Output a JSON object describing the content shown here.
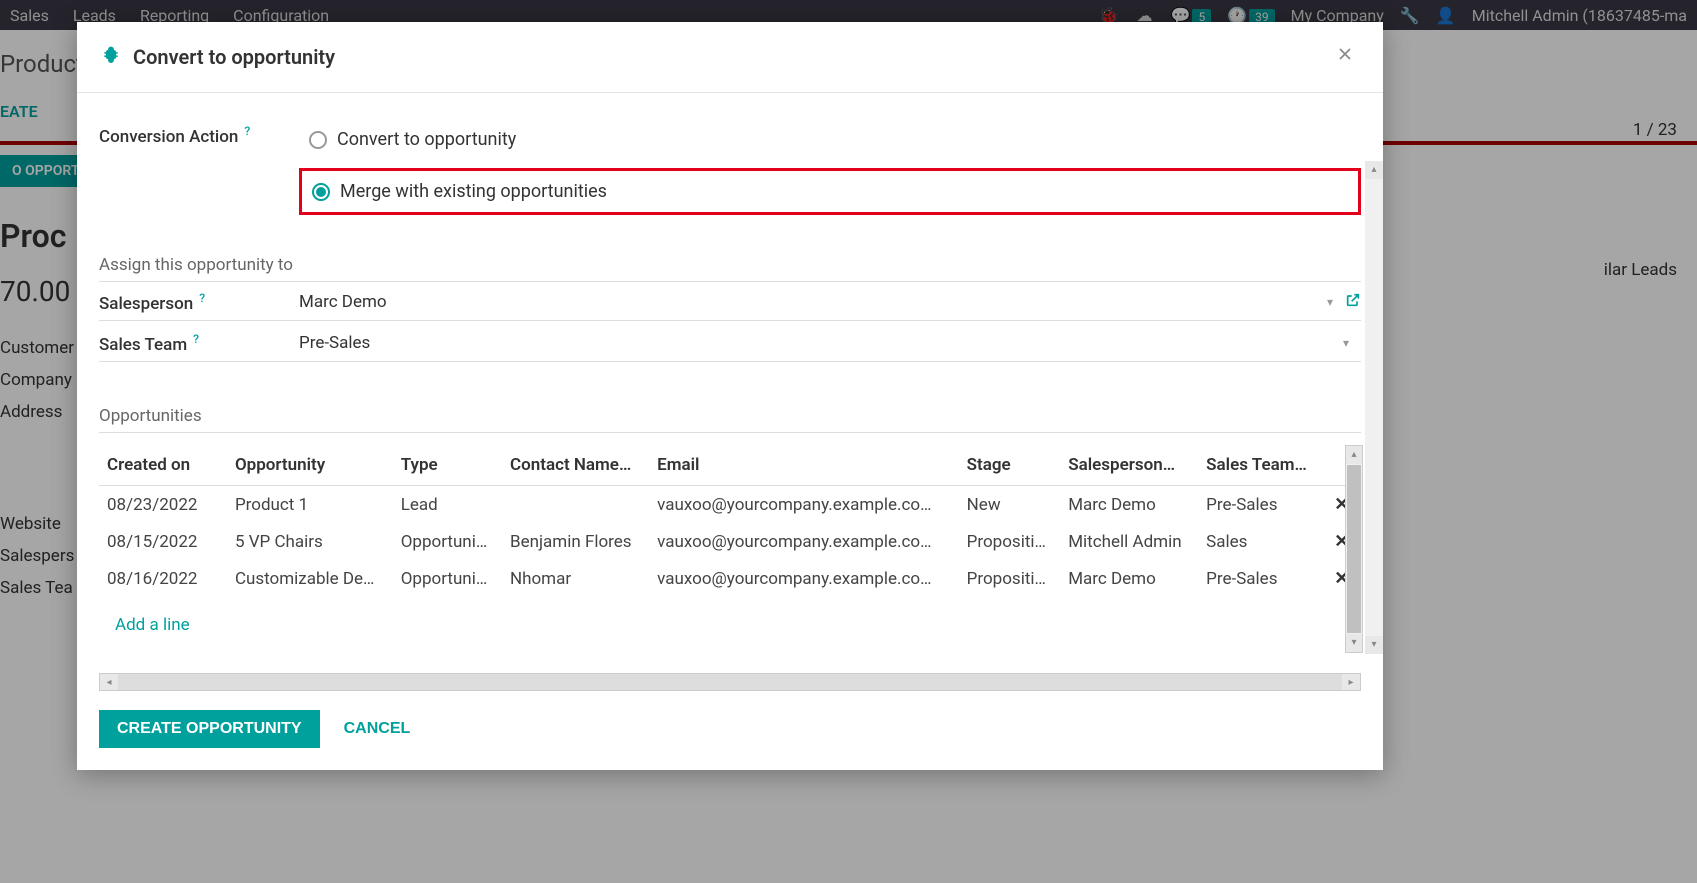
{
  "nav": {
    "items": [
      "Sales",
      "Leads",
      "Reporting",
      "Configuration"
    ],
    "badge1": "5",
    "badge2": "39",
    "company": "My Company",
    "user": "Mitchell Admin (18637485-ma"
  },
  "bg": {
    "product": "Product",
    "create": "EATE",
    "opport": "O OPPORT",
    "big": "Proc",
    "num": "70.00",
    "customer": "Customer",
    "company": "Company",
    "address": "Address",
    "website": "Website",
    "salespers": "Salespers",
    "salestea": "Sales Tea",
    "pager": "1 / 23",
    "similar": "ilar Leads"
  },
  "modal": {
    "title": "Convert to opportunity",
    "conversion_label": "Conversion Action",
    "radio1": "Convert to opportunity",
    "radio2": "Merge with existing opportunities",
    "assign_header": "Assign this opportunity to",
    "salesperson_label": "Salesperson",
    "salesperson_value": "Marc Demo",
    "salesteam_label": "Sales Team",
    "salesteam_value": "Pre-Sales",
    "opps_header": "Opportunities",
    "columns": {
      "created": "Created on",
      "opp": "Opportunity",
      "type": "Type",
      "contact": "Contact Name…",
      "email": "Email",
      "stage": "Stage",
      "sp": "Salesperson…",
      "st": "Sales Team…"
    },
    "rows": [
      {
        "created": "08/23/2022",
        "opp": "Product 1",
        "type": "Lead",
        "contact": "",
        "email": "vauxoo@yourcompany.example.co…",
        "stage": "New",
        "sp": "Marc Demo",
        "st": "Pre-Sales"
      },
      {
        "created": "08/15/2022",
        "opp": "5 VP Chairs",
        "type": "Opportuni…",
        "contact": "Benjamin Flores",
        "email": "vauxoo@yourcompany.example.co…",
        "stage": "Propositi…",
        "sp": "Mitchell Admin",
        "st": "Sales"
      },
      {
        "created": "08/16/2022",
        "opp": "Customizable De…",
        "type": "Opportuni…",
        "contact": "Nhomar",
        "email": "vauxoo@yourcompany.example.co…",
        "stage": "Propositi…",
        "sp": "Marc Demo",
        "st": "Pre-Sales"
      }
    ],
    "add_line": "Add a line",
    "create_btn": "CREATE OPPORTUNITY",
    "cancel_btn": "CANCEL"
  }
}
